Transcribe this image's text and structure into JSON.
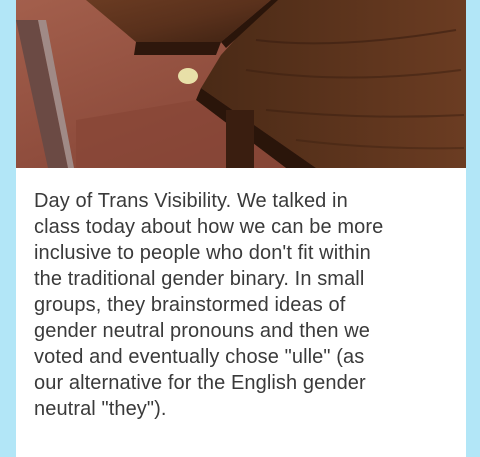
{
  "post": {
    "image_description_icon": "photo-desk-carpet",
    "text": "Day of Trans Visibility. We talked in\nclass today about how we can be more\ninclusive to people who don't fit within\nthe traditional gender binary. In small\ngroups, they brainstormed ideas of\ngender neutral pronouns and then we\nvoted and eventually chose \"ulle\" (as\nour alternative for the English gender\nneutral \"they\")."
  },
  "colors": {
    "background": "#b2e6f7",
    "card": "#ffffff",
    "text": "#3a3a3a"
  }
}
